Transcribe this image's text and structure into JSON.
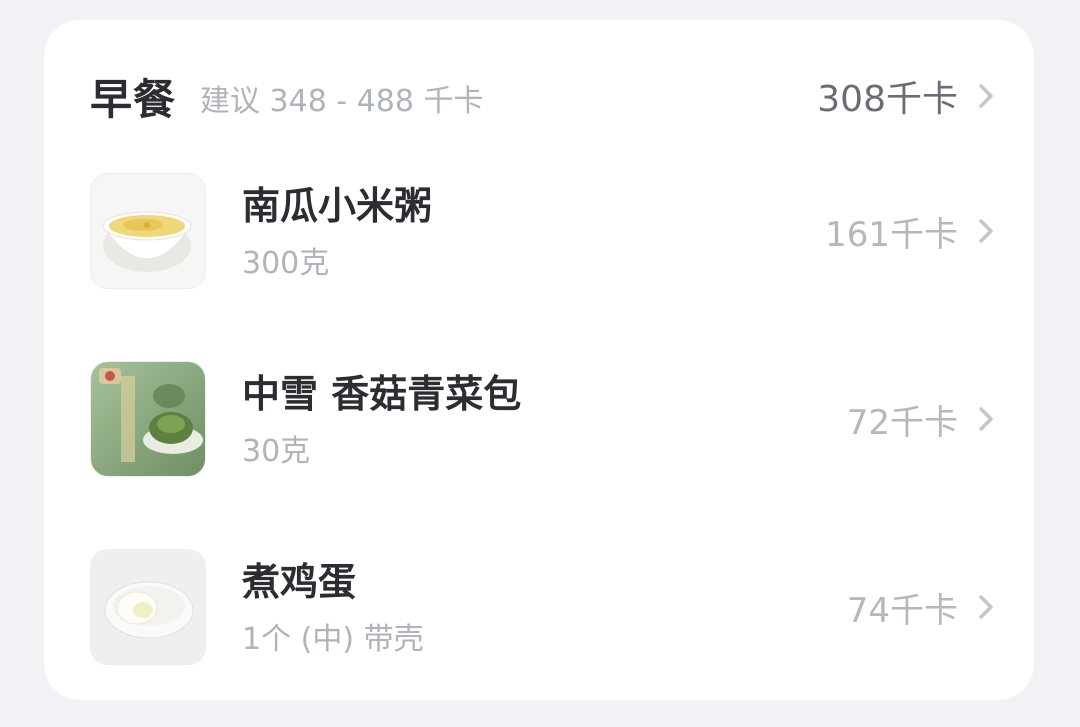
{
  "meal": {
    "title": "早餐",
    "suggestion": "建议 348 - 488 千卡",
    "total": "308千卡"
  },
  "foods": [
    {
      "name": "南瓜小米粥",
      "amount": "300克",
      "kcal": "161千卡",
      "icon": "pumpkin-millet-porridge-image"
    },
    {
      "name": "中雪 香菇青菜包",
      "amount": "30克",
      "kcal": "72千卡",
      "icon": "mushroom-vegetable-bun-image"
    },
    {
      "name": "煮鸡蛋",
      "amount": "1个 (中) 带壳",
      "kcal": "74千卡",
      "icon": "boiled-egg-image"
    }
  ],
  "colors": {
    "background": "#f1f2f6",
    "card": "#ffffff",
    "primary_text": "#2b2d33",
    "secondary_text": "#b0b3ba",
    "chevron": "#c4c6cc"
  }
}
